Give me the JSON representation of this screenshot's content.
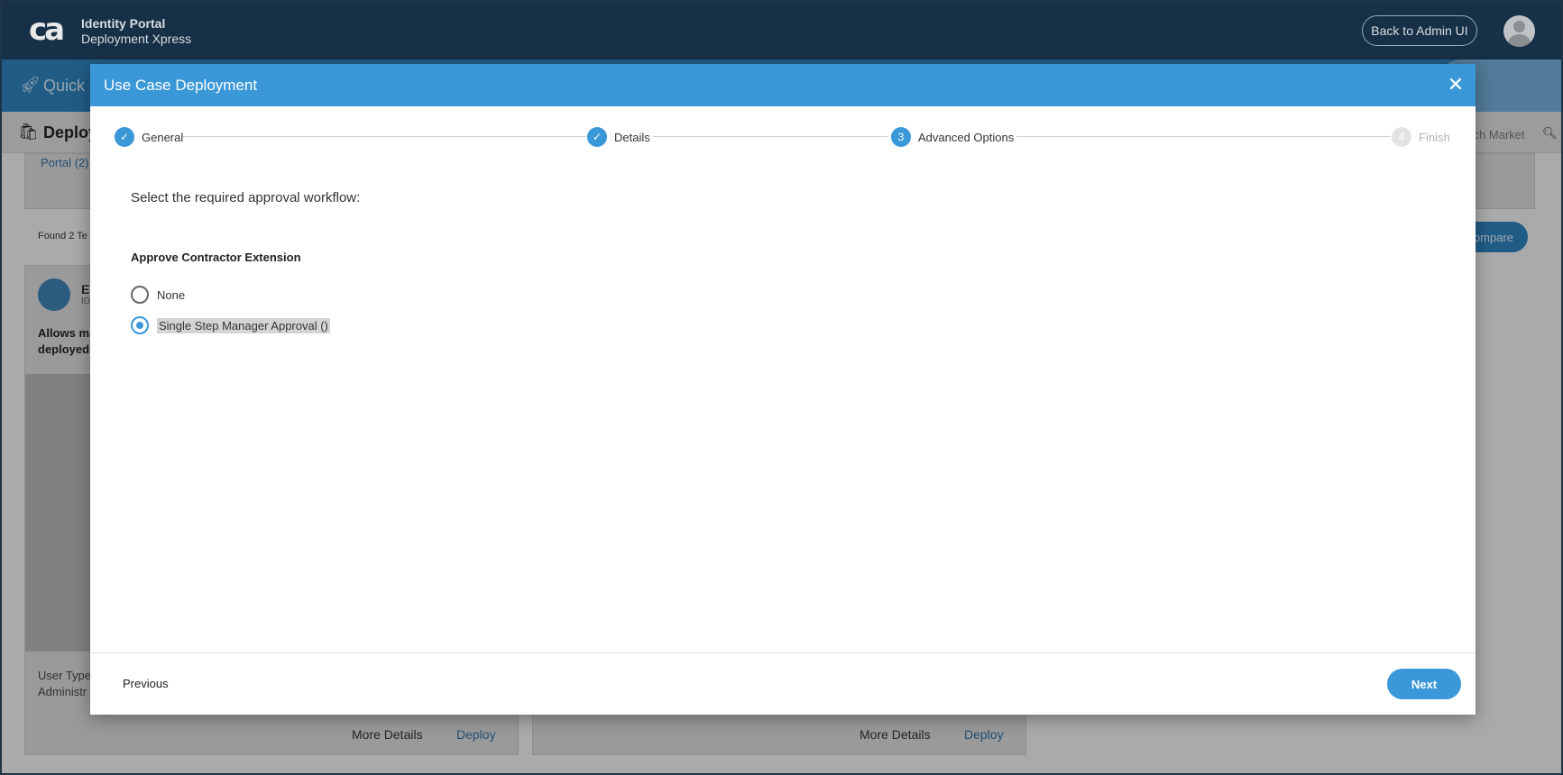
{
  "header": {
    "logo_text": "ca",
    "brand_title": "Identity Portal",
    "brand_subtitle": "Deployment Xpress",
    "back_button": "Back to Admin UI"
  },
  "background": {
    "quick_label": "Quick",
    "deploy_label": "Deploy",
    "portal_link": "Portal (2)",
    "found_text": "Found 2 Te",
    "search_placeholder": "arch Market",
    "compare_button": "ompare",
    "card": {
      "name": "E",
      "id": "ID",
      "description": "Allows ma deployed,",
      "user_type": "User Type",
      "user_type_value": "Administr"
    },
    "more_details": "More Details",
    "deploy": "Deploy"
  },
  "modal": {
    "title": "Use Case Deployment",
    "steps": [
      {
        "label": "General",
        "state": "done",
        "number": "1"
      },
      {
        "label": "Details",
        "state": "done",
        "number": "2"
      },
      {
        "label": "Advanced Options",
        "state": "active",
        "number": "3"
      },
      {
        "label": "Finish",
        "state": "pending",
        "number": "4"
      }
    ],
    "instruction": "Select the required approval workflow:",
    "section_label": "Approve Contractor Extension",
    "options": [
      {
        "label": "None",
        "selected": false
      },
      {
        "label": "Single Step Manager Approval ()",
        "selected": true
      }
    ],
    "previous_button": "Previous",
    "next_button": "Next"
  },
  "colors": {
    "header_bg": "#163047",
    "accent": "#3a97d8",
    "modal_header": "#3a97d8"
  }
}
